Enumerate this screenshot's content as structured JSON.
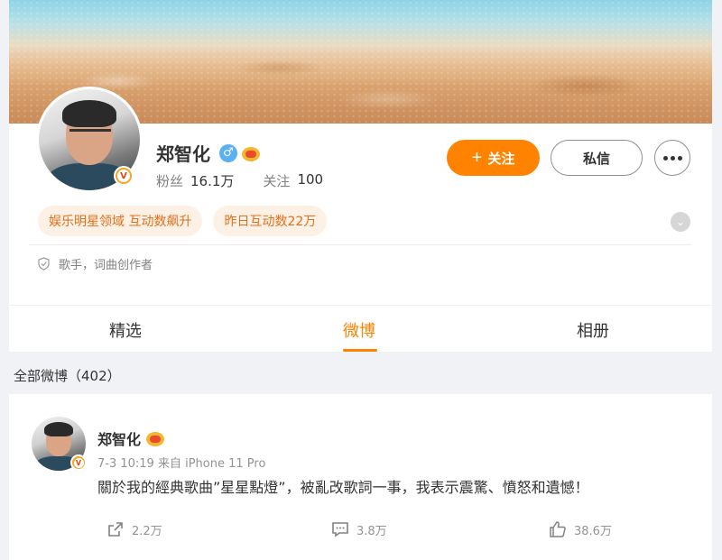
{
  "profile": {
    "name": "郑智化",
    "gender_icon": "male-icon",
    "stats": {
      "fans_label": "粉丝",
      "fans_value": "16.1万",
      "following_label": "关注",
      "following_value": "100"
    },
    "buttons": {
      "follow": "关注",
      "message": "私信"
    },
    "tags": [
      "娱乐明星领域 互动数飙升",
      "昨日互动数22万"
    ],
    "bio": "歌手，词曲创作者"
  },
  "tabs": [
    {
      "label": "精选",
      "active": false
    },
    {
      "label": "微博",
      "active": true
    },
    {
      "label": "相册",
      "active": false
    }
  ],
  "feed": {
    "section_label": "全部微博（402）"
  },
  "post": {
    "author": "郑智化",
    "meta": "7-3 10:19  来自 iPhone 11 Pro",
    "text": "關於我的經典歌曲”星星點燈”，被亂改歌詞一事，我表示震驚、憤怒和遺憾！",
    "repost_count": "2.2万",
    "comment_count": "3.8万",
    "like_count": "38.6万"
  },
  "colors": {
    "accent": "#ff8200",
    "tag_text": "#e26f1c",
    "tag_bg": "#fdf0e4",
    "male_icon": "#5ab0f0",
    "background": "#f1f2f5"
  }
}
